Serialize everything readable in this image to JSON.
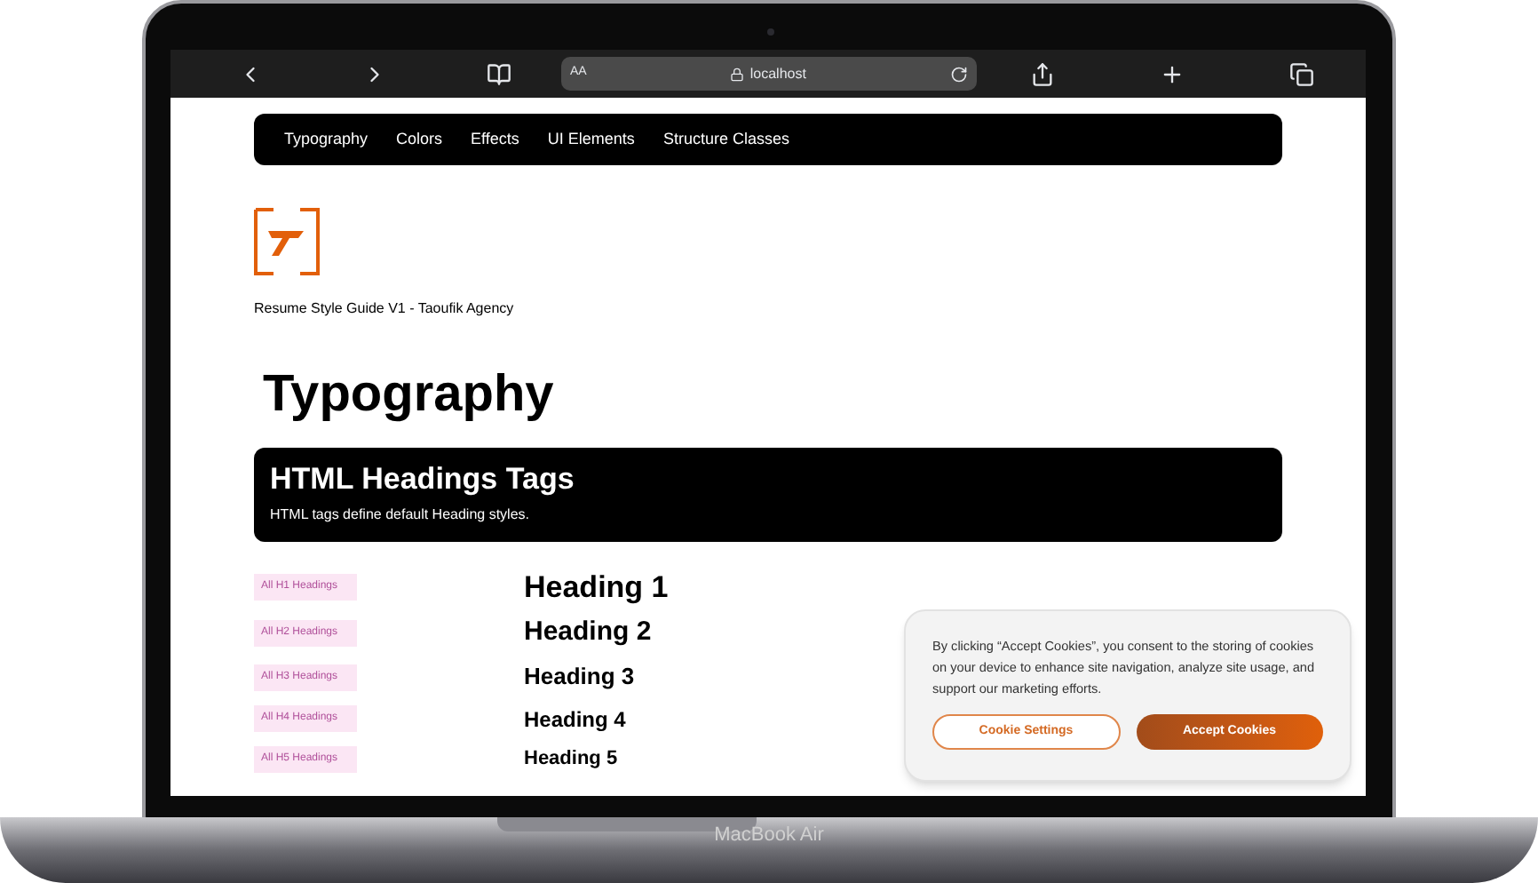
{
  "browser": {
    "text_size_button": "AA",
    "address": "localhost"
  },
  "nav": {
    "items": [
      "Typography",
      "Colors",
      "Effects",
      "UI Elements",
      "Structure Classes"
    ]
  },
  "subtitle": "Resume Style Guide V1 - Taoufik Agency",
  "page_title": "Typography",
  "section": {
    "title": "HTML Headings Tags",
    "description": "HTML tags define default Heading styles."
  },
  "headings": [
    {
      "tag": "All H1 Headings",
      "sample": "Heading 1"
    },
    {
      "tag": "All H2 Headings",
      "sample": "Heading 2"
    },
    {
      "tag": "All H3 Headings",
      "sample": "Heading 3"
    },
    {
      "tag": "All H4 Headings",
      "sample": "Heading 4"
    },
    {
      "tag": "All H5 Headings",
      "sample": "Heading 5"
    }
  ],
  "cookie_banner": {
    "text": "By clicking “Accept Cookies”, you consent to the storing of cookies on your device to enhance site navigation, analyze site usage, and support our marketing efforts.",
    "buttons": [
      {
        "label": "Cookie Settings",
        "kind": "outline"
      },
      {
        "label": "Accept Cookies",
        "kind": "primary"
      }
    ]
  },
  "device_label": "MacBook Air"
}
